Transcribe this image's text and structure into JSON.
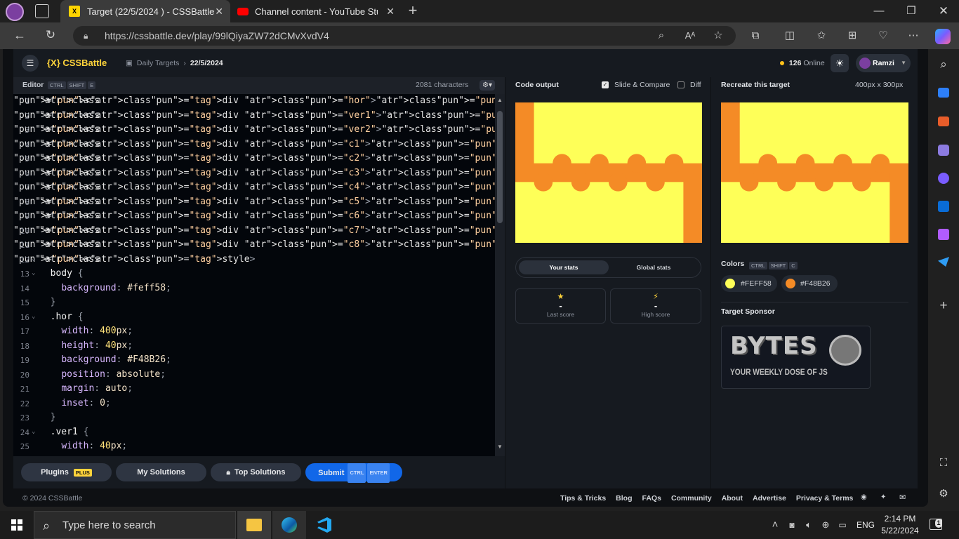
{
  "browser": {
    "tabs": [
      {
        "label": "Target (22/5/2024 ) - CSSBattle",
        "active": true
      },
      {
        "label": "Channel content - YouTube Studi",
        "active": false
      }
    ],
    "url": "https://cssbattle.dev/play/99lQiyaZW72dCMvXvdV4"
  },
  "app": {
    "logo": "{X} CSSBattle",
    "breadcrumb_parent": "Daily Targets",
    "breadcrumb_current": "22/5/2024",
    "online_count": "126",
    "online_label": "Online",
    "user": "Ramzi"
  },
  "editor": {
    "title": "Editor",
    "shortcut": [
      "CTRL",
      "SHIFT",
      "E"
    ],
    "characters": "2081 characters",
    "lines": [
      "<div class=\"hor\"></div>",
      "<div class=\"ver1\"></div>",
      "<div class=\"ver2\"></div>",
      "<div class=\"c1\"></div>",
      "<div class=\"c2\"></div>",
      "<div class=\"c3\"></div>",
      "<div class=\"c4\"></div>",
      "<div class=\"c5\"></div>",
      "<div class=\"c6\"></div>",
      "<div class=\"c7\"></div>",
      "<div class=\"c8\"></div>",
      "<style>",
      "  body {",
      "    background: #feff58;",
      "  }",
      "  .hor {",
      "    width: 400px;",
      "    height: 40px;",
      "    background: #F48B26;",
      "    position: absolute;",
      "    margin: auto;",
      "    inset: 0;",
      "  }",
      "  .ver1 {",
      "    width: 40px;"
    ]
  },
  "buttons": {
    "plugins": "Plugins",
    "plugins_badge": "PLUS",
    "my_solutions": "My Solutions",
    "top_solutions": "Top Solutions",
    "submit": "Submit",
    "submit_keys": [
      "CTRL",
      "ENTER"
    ]
  },
  "output": {
    "title": "Code output",
    "slide_compare": "Slide & Compare",
    "diff": "Diff"
  },
  "target": {
    "title": "Recreate this target",
    "size": "400px x 300px"
  },
  "stats": {
    "tab_your": "Your stats",
    "tab_global": "Global stats",
    "last_score_value": "-",
    "last_score_label": "Last score",
    "high_score_value": "-",
    "high_score_label": "High score"
  },
  "colors": {
    "title": "Colors",
    "keys": [
      "CTRL",
      "SHIFT",
      "C"
    ],
    "swatches": [
      "#FEFF58",
      "#F48B26"
    ]
  },
  "sponsor": {
    "title": "Target Sponsor",
    "logo_text": "BYTES",
    "tagline": "YOUR WEEKLY DOSE OF JS"
  },
  "footer": {
    "copyright": "© 2024 CSSBattle",
    "links": [
      "Tips & Tricks",
      "Blog",
      "FAQs",
      "Community",
      "About",
      "Advertise",
      "Privacy & Terms"
    ]
  },
  "taskbar": {
    "search_placeholder": "Type here to search",
    "language": "ENG",
    "time": "2:14 PM",
    "date": "5/22/2024",
    "notification_count": "1"
  }
}
